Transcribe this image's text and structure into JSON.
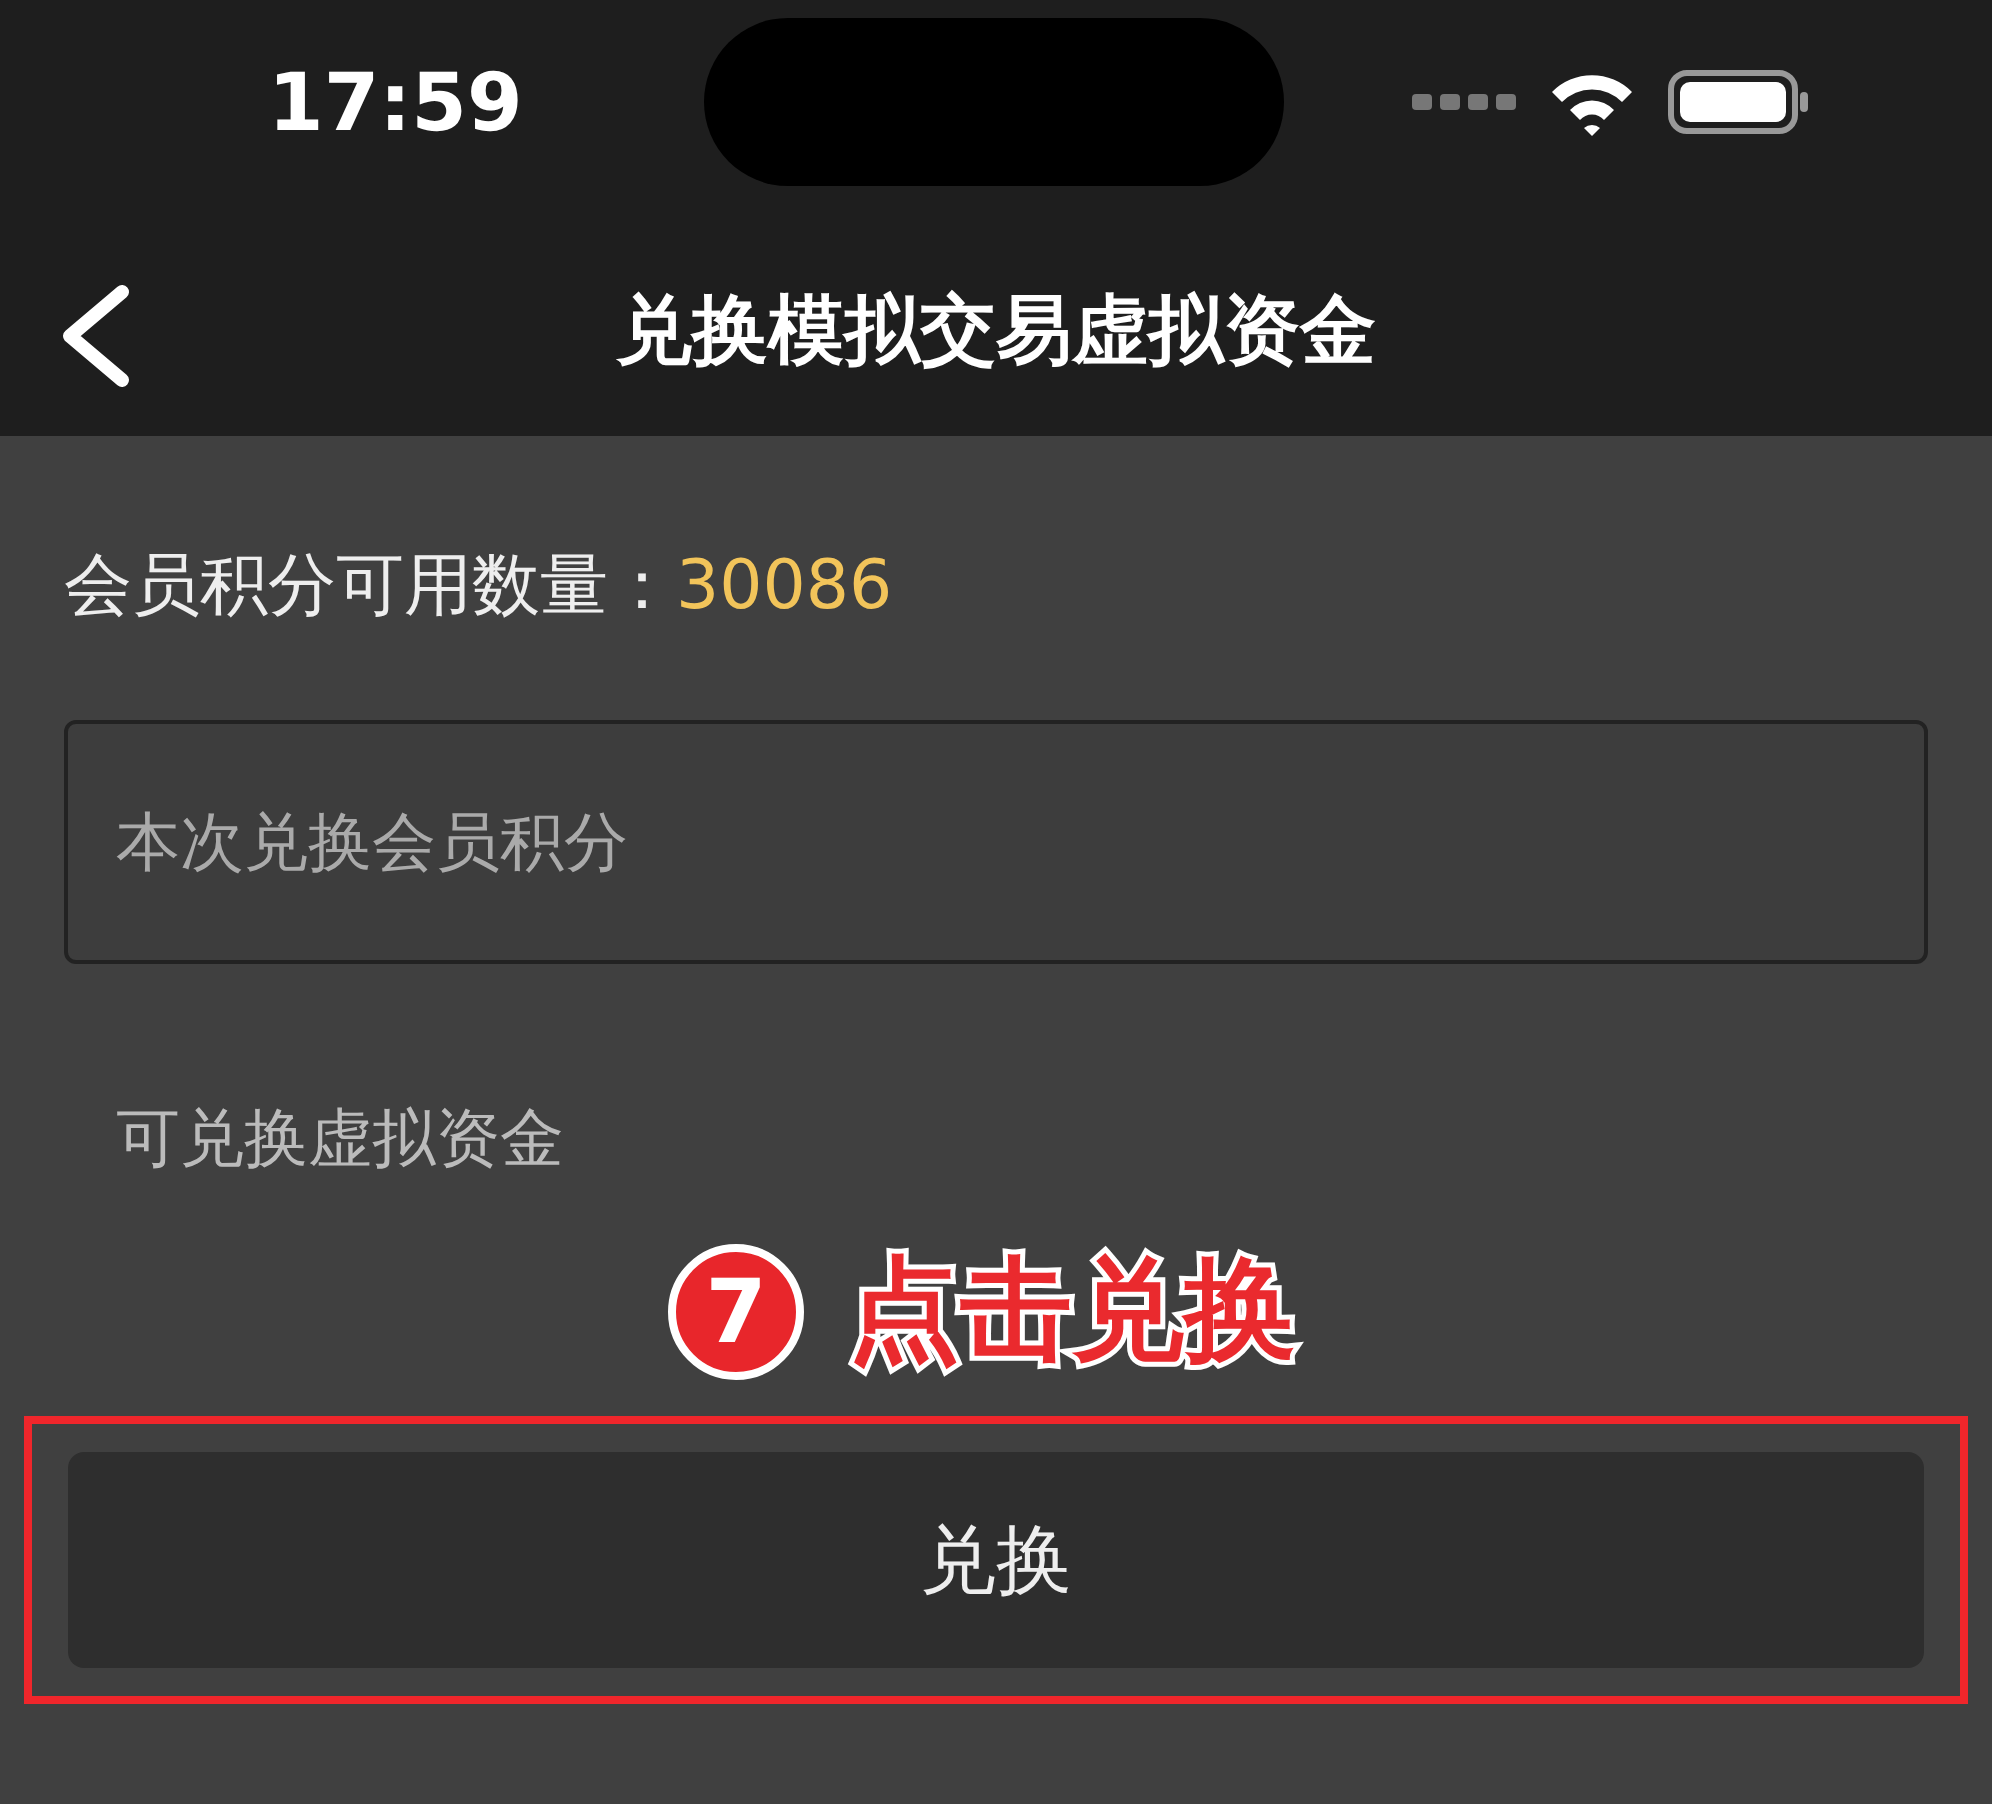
{
  "status_bar": {
    "time": "17:59"
  },
  "nav": {
    "title": "兑换模拟交易虚拟资金"
  },
  "points": {
    "label": "会员积分可用数量：",
    "value": "30086"
  },
  "exchange_input": {
    "placeholder": "本次兑换会员积分"
  },
  "result_label": "可兑换虚拟资金",
  "annotation": {
    "step": "7",
    "text": "点击兑换"
  },
  "button": {
    "label": "兑换",
    "highlighted": true
  }
}
